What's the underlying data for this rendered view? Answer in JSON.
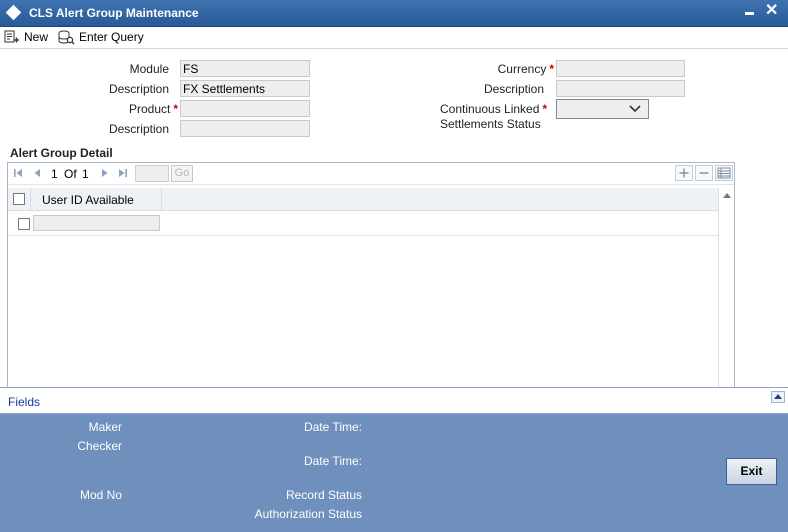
{
  "window": {
    "title": "CLS Alert Group Maintenance",
    "close_glyph": "✕"
  },
  "toolbar": {
    "new_label": "New",
    "enter_query_label": "Enter Query"
  },
  "form": {
    "module_label": "Module",
    "module_value": "FS",
    "description_label": "Description",
    "module_description_value": "FX Settlements",
    "product_label": "Product",
    "product_value": "",
    "product_description_value": "",
    "currency_label": "Currency",
    "currency_value": "",
    "currency_description_value": "",
    "cls_status_label_line1": "Continuous Linked",
    "cls_status_label_line2": "Settlements Status",
    "cls_status_value": "",
    "required_mark": "*"
  },
  "grid": {
    "section_title": "Alert Group Detail",
    "pager": {
      "current": "1",
      "of_label": "Of",
      "total": "1",
      "go_label": "Go"
    },
    "columns": [
      "User ID Available"
    ],
    "rows": [
      {
        "user_id": ""
      }
    ]
  },
  "fields_bar": {
    "label": "Fields"
  },
  "footer": {
    "maker_label": "Maker",
    "checker_label": "Checker",
    "date_time_label": "Date Time:",
    "mod_no_label": "Mod No",
    "record_status_label": "Record Status",
    "authorization_status_label": "Authorization Status",
    "exit_label": "Exit"
  },
  "colors": {
    "title_bar": "#2f64a4",
    "footer": "#6f8fbd",
    "required": "#cc0000",
    "link": "#1a3b9c"
  }
}
